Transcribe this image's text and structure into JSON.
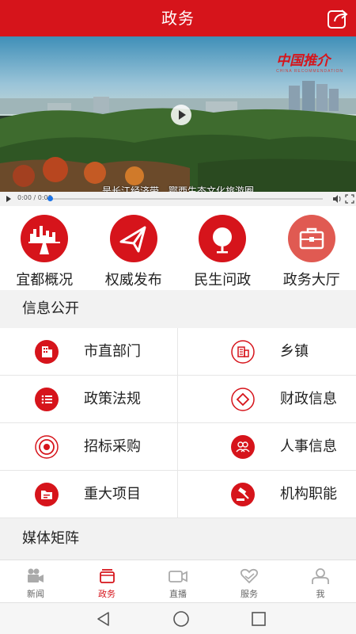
{
  "header": {
    "title": "政务"
  },
  "video": {
    "watermark": "中国推介",
    "watermark_sub": "CHINA RECOMMENDATION",
    "subtitle": "是长江经济带、鄂西生态文化旅游圈",
    "time": "0:00 / 0:00"
  },
  "quick": [
    {
      "label": "宜都概况",
      "icon": "city-icon"
    },
    {
      "label": "权威发布",
      "icon": "paper-plane-icon"
    },
    {
      "label": "民生问政",
      "icon": "microphone-icon"
    },
    {
      "label": "政务大厅",
      "icon": "briefcase-icon"
    }
  ],
  "sections": {
    "info_title": "信息公开",
    "media_title": "媒体矩阵"
  },
  "info": [
    {
      "label": "市直部门",
      "icon": "building-icon"
    },
    {
      "label": "乡镇",
      "icon": "town-icon"
    },
    {
      "label": "政策法规",
      "icon": "list-icon"
    },
    {
      "label": "财政信息",
      "icon": "diamond-icon"
    },
    {
      "label": "招标采购",
      "icon": "target-icon"
    },
    {
      "label": "人事信息",
      "icon": "people-icon"
    },
    {
      "label": "重大项目",
      "icon": "folder-icon"
    },
    {
      "label": "机构职能",
      "icon": "gavel-icon"
    }
  ],
  "tabs": [
    {
      "label": "新闻",
      "icon": "camera-icon"
    },
    {
      "label": "政务",
      "icon": "layers-icon",
      "active": true
    },
    {
      "label": "直播",
      "icon": "video-icon"
    },
    {
      "label": "服务",
      "icon": "heart-icon"
    },
    {
      "label": "我",
      "icon": "user-icon"
    }
  ],
  "colors": {
    "brand": "#d6141b",
    "quick_gray": "#e05a52"
  }
}
